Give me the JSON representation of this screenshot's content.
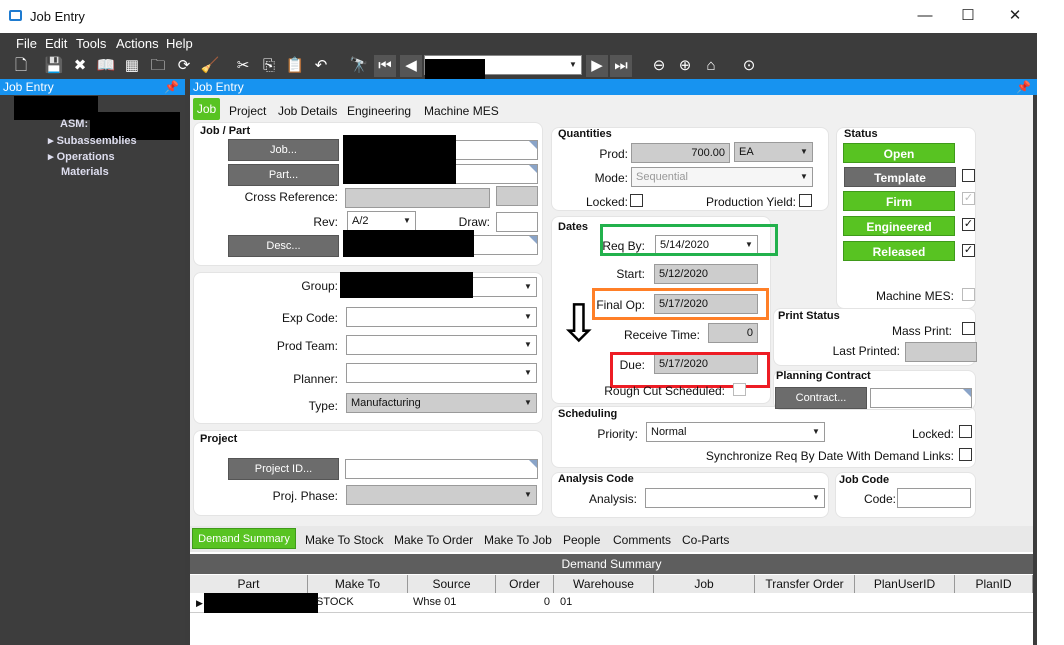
{
  "window": {
    "title": "Job Entry",
    "min": "—",
    "max": "☐",
    "close": "✕"
  },
  "menu": [
    "File",
    "Edit",
    "Tools",
    "Actions",
    "Help"
  ],
  "left": {
    "header": "Job Entry",
    "tree": {
      "asm": "ASM:",
      "subassemblies": "Subassemblies",
      "operations": "Operations",
      "materials": "Materials"
    }
  },
  "panel": {
    "header": "Job Entry"
  },
  "tabs": [
    "Job",
    "Project",
    "Job Details",
    "Engineering",
    "Machine MES"
  ],
  "jobpart": {
    "title": "Job / Part",
    "job_btn": "Job...",
    "part_btn": "Part...",
    "crossref": "Cross Reference:",
    "rev": "Rev:",
    "rev_value": "A/2",
    "draw": "Draw:",
    "desc_btn": "Desc..."
  },
  "groupbox": {
    "group": "Group:",
    "exp": "Exp Code:",
    "prodteam": "Prod Team:",
    "planner": "Planner:",
    "type": "Type:",
    "type_value": "Manufacturing"
  },
  "project": {
    "title": "Project",
    "id_btn": "Project ID...",
    "phase": "Proj. Phase:"
  },
  "quantities": {
    "title": "Quantities",
    "prod": "Prod:",
    "prod_value": "700.00",
    "uom": "EA",
    "mode": "Mode:",
    "mode_value": "Sequential",
    "locked": "Locked:",
    "yield": "Production Yield:"
  },
  "dates": {
    "title": "Dates",
    "reqby": "Req By:",
    "reqby_value": "5/14/2020",
    "start": "Start:",
    "start_value": "5/12/2020",
    "finalop": "Final Op:",
    "finalop_value": "5/17/2020",
    "receive": "Receive Time:",
    "receive_value": "0",
    "due": "Due:",
    "due_value": "5/17/2020",
    "rough": "Rough Cut Scheduled:"
  },
  "scheduling": {
    "title": "Scheduling",
    "priority": "Priority:",
    "priority_value": "Normal",
    "locked": "Locked:",
    "sync": "Synchronize Req By Date With Demand Links:"
  },
  "analysis": {
    "title": "Analysis Code",
    "label": "Analysis:"
  },
  "jobcode": {
    "title": "Job Code",
    "label": "Code:"
  },
  "status": {
    "title": "Status",
    "open": "Open",
    "template": "Template",
    "firm": "Firm",
    "engineered": "Engineered",
    "released": "Released",
    "machine": "Machine MES:"
  },
  "print": {
    "title": "Print Status",
    "mass": "Mass Print:",
    "last": "Last Printed:"
  },
  "planning": {
    "title": "Planning Contract",
    "btn": "Contract..."
  },
  "bottomtabs": [
    "Demand Summary",
    "Make To Stock",
    "Make To Order",
    "Make To Job",
    "People",
    "Comments",
    "Co-Parts"
  ],
  "grid": {
    "caption": "Demand Summary",
    "columns": [
      "Part",
      "Make To",
      "Source",
      "Order",
      "Warehouse",
      "Job",
      "Transfer Order",
      "PlanUserID",
      "PlanID"
    ],
    "row": {
      "maketo": "STOCK",
      "source": "Whse 01",
      "order": "0",
      "warehouse": "01"
    }
  },
  "arrow": "⇩"
}
